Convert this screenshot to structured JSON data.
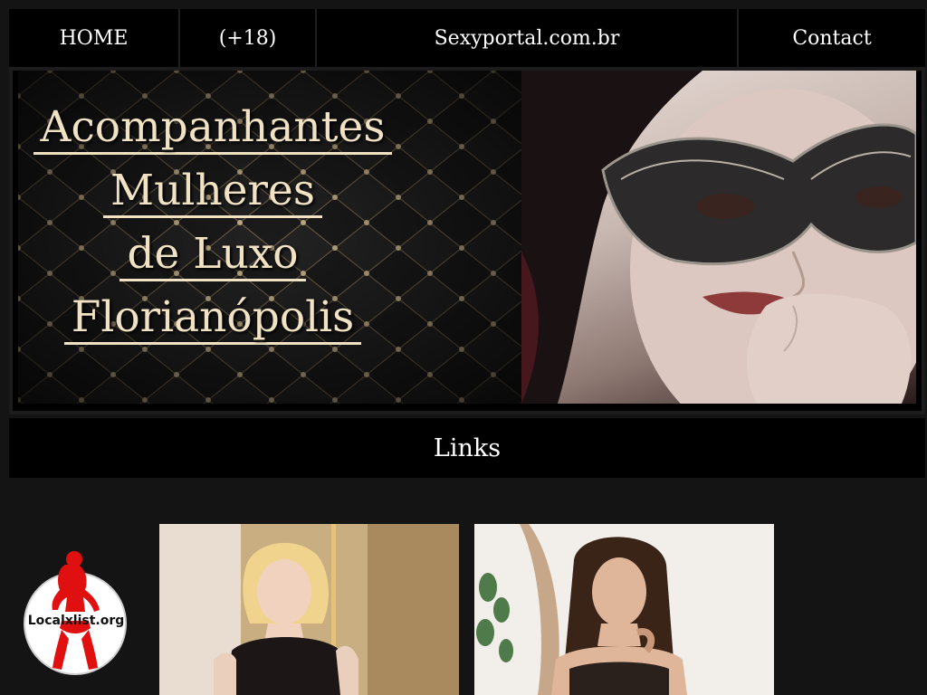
{
  "nav": {
    "home": "HOME",
    "adult": "(+18)",
    "site": "Sexyportal.com.br",
    "contact": "Contact"
  },
  "banner": {
    "lines": [
      "Acompanhantes",
      "Mulheres",
      "de Luxo",
      "Florianópolis"
    ],
    "image": "masked-woman-photo"
  },
  "links_header": "Links",
  "badge": {
    "label": "Localxlist.org",
    "icon": "woman-silhouette-icon"
  },
  "cards": [
    {
      "image": "blonde-woman-photo"
    },
    {
      "image": "brunette-woman-photo"
    }
  ],
  "colors": {
    "background": "#141414",
    "bar": "#000000",
    "banner_text": "#f1e2c4",
    "badge_red": "#e01010"
  }
}
